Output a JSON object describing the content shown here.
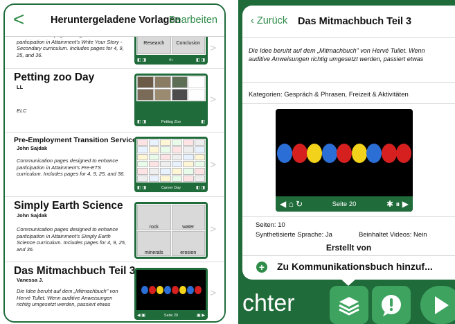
{
  "left": {
    "back_label": "<",
    "title": "Heruntergeladene Vorlagen",
    "edit_label": "Bearbeiten",
    "partial_desc": "Communication pages designed to enhance participation in Attainment's Write Your Story - Secondary curriculum. Includes pages for 4, 9, 25, and 36.",
    "partial_thumb_labels": [
      "Research",
      "Conclusion"
    ],
    "partial_thumb_bar": "4+",
    "items": [
      {
        "title": "Petting zoo Day",
        "author": "LL",
        "desc": "ELC",
        "thumb_bar": "Petting Zoo"
      },
      {
        "title": "Pre-Employment Transition Services",
        "author": "John Sajdak",
        "desc": "Communication pages designed to enhance participation in Attainment's Pre-ETS curriculum.  Includes pages for 4, 9, 25, and 36.",
        "thumb_bar": "Career Day"
      },
      {
        "title": "Simply Earth Science",
        "author": "John Sajdak",
        "desc": "Communication pages designed to enhance participation in Attainment's Simply Earth Science curriculum.  Includes pages for 4, 9, 25, and 36.",
        "thumb_labels": [
          "rock",
          "water",
          "minerals",
          "erosion"
        ]
      },
      {
        "title": "Das Mitmachbuch Teil 3",
        "author": "Vanessa J.",
        "desc": "Die Idee beruht auf dem „Mitmachbuch\" von Hervé Tullet. Wenn auditive Anweisungen richtig umgesetzt werden, passiert etwas",
        "thumb_bar": "Seite 20"
      }
    ],
    "chevron": ">"
  },
  "right": {
    "back_label": "Zurück",
    "title": "Das Mitmachbuch Teil 3",
    "description": "Die Idee beruht auf dem „Mitmachbuch\" von Hervé Tullet. Wenn auditive Anweisungen richtig umgesetzt werden, passiert etwas",
    "categories": "Kategorien: Gespräch & Phrasen, Freizeit & Aktivitäten",
    "preview_bar": "Seite 20",
    "pages": "Seiten: 10",
    "speech": "Synthetisierte Sprache: Ja",
    "videos": "Beinhaltet Videos: Nein",
    "created_by": "Erstellt von",
    "add_button": "Zu Kommunikationsbuch hinzuf..."
  },
  "bottom": {
    "partial_text": "chter"
  },
  "balloon_colors": [
    "#2b6fd6",
    "#d62020",
    "#f2d21b",
    "#2b6fd6",
    "#d62020",
    "#f2d21b",
    "#2b6fd6",
    "#d62020"
  ],
  "colors": {
    "accent": "#2e8b48",
    "frame": "#1f6b3a",
    "tool": "#3fa360"
  }
}
